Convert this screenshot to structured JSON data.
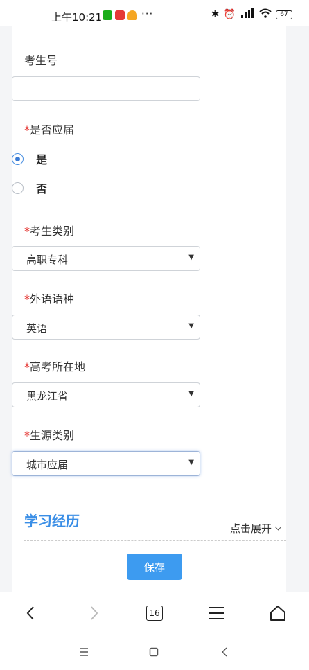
{
  "status_bar": {
    "time": "上午10:21",
    "dots": "···",
    "battery": "67",
    "icons": [
      "wechat-icon",
      "app-icon",
      "app2-icon",
      "bluetooth-icon",
      "alarm-icon",
      "signal-icon",
      "wifi-icon",
      "battery-icon"
    ],
    "app_colors": [
      "#1aad19",
      "#e53935",
      "#f5a623"
    ]
  },
  "form": {
    "exam_number": {
      "label": "考生号",
      "value": ""
    },
    "fresh_graduate": {
      "required_mark": "*",
      "label": "是否应届",
      "options": [
        {
          "label": "是",
          "selected": true
        },
        {
          "label": "否",
          "selected": false
        }
      ]
    },
    "candidate_type": {
      "required_mark": "*",
      "label": "考生类别",
      "value": "高职专科"
    },
    "foreign_language": {
      "required_mark": "*",
      "label": "外语语种",
      "value": "英语"
    },
    "exam_location": {
      "required_mark": "*",
      "label": "高考所在地",
      "value": "黑龙江省"
    },
    "source_type": {
      "required_mark": "*",
      "label": "生源类别",
      "value": "城市应届"
    }
  },
  "study_section": {
    "title": "学习经历",
    "expand_label": "点击展开"
  },
  "save_button": "保存",
  "browser_nav": {
    "tab_count": "16"
  },
  "colors": {
    "accent": "#3d9bf0",
    "required": "#e53935",
    "section_title": "#3a8ee6"
  }
}
